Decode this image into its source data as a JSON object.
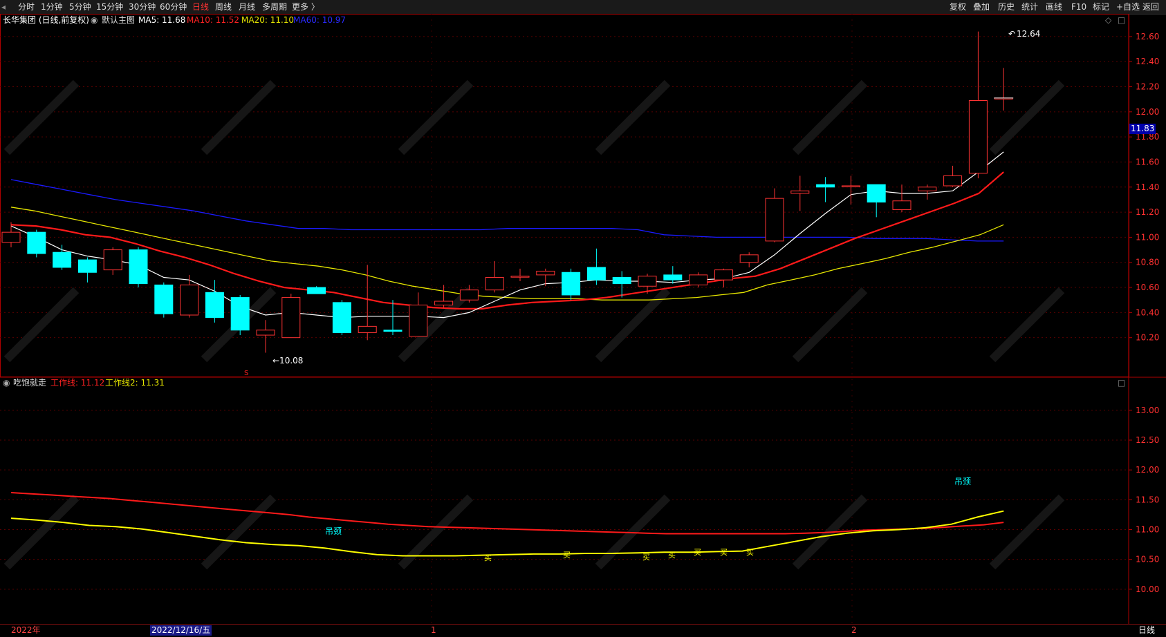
{
  "toolbar": {
    "left_tabs": [
      {
        "label": "分时"
      },
      {
        "label": "1分钟"
      },
      {
        "label": "5分钟"
      },
      {
        "label": "15分钟"
      },
      {
        "label": "30分钟"
      },
      {
        "label": "60分钟"
      },
      {
        "label": "日线"
      },
      {
        "label": "周线"
      },
      {
        "label": "月线"
      },
      {
        "label": "多周期"
      },
      {
        "label": "更多 〉"
      }
    ],
    "active_tab": "日线",
    "right_buttons": [
      {
        "label": "复权"
      },
      {
        "label": "叠加"
      },
      {
        "label": "历史"
      },
      {
        "label": "统计"
      },
      {
        "label": "画线"
      },
      {
        "label": "F10"
      },
      {
        "label": "标记"
      },
      {
        "label": "+自选"
      },
      {
        "label": "返回"
      }
    ]
  },
  "main_header": {
    "stock": "长华集团 (日线,前复权)",
    "indicator": "默认主图",
    "ma5": "MA5: 11.68",
    "ma10": "MA10: 11.52",
    "ma20": "MA20: 11.10",
    "ma60": "MA60: 10.97"
  },
  "sub_header": {
    "indicator": "吃饱就走",
    "line1": "工作线: 11.12",
    "line2": "工作线2: 11.31"
  },
  "colors": {
    "up": "#ff3333",
    "down": "#00ffff",
    "ma5": "#ffffff",
    "ma10": "#ff1a1a",
    "ma20": "#e6e600",
    "ma60": "#1a1aff",
    "grid": "#5a0000",
    "axis": "#b00000"
  },
  "annotations": {
    "high_label": "12.64",
    "low_label": "←10.08",
    "current_price": "11.83",
    "s_marker": "S",
    "diaoding": "吊颈",
    "buy": "买"
  },
  "bottom": {
    "year_label": "2022年",
    "date_label": "2022/12/16/五",
    "month1": "1",
    "month2": "2",
    "period": "日线"
  },
  "chart_data": {
    "type": "candlestick",
    "title": "长华集团 (日线,前复权)",
    "price_axis_ticks": [
      12.6,
      12.4,
      12.2,
      12.0,
      11.8,
      11.6,
      11.4,
      11.2,
      11.0,
      10.8,
      10.6,
      10.4,
      10.2
    ],
    "price_range": [
      10.0,
      12.66
    ],
    "candles": [
      {
        "o": 10.96,
        "h": 11.12,
        "l": 10.92,
        "c": 11.04
      },
      {
        "o": 11.04,
        "h": 11.06,
        "l": 10.84,
        "c": 10.87
      },
      {
        "o": 10.88,
        "h": 10.94,
        "l": 10.74,
        "c": 10.76
      },
      {
        "o": 10.82,
        "h": 10.84,
        "l": 10.64,
        "c": 10.72
      },
      {
        "o": 10.74,
        "h": 10.92,
        "l": 10.7,
        "c": 10.9
      },
      {
        "o": 10.9,
        "h": 10.92,
        "l": 10.6,
        "c": 10.63
      },
      {
        "o": 10.62,
        "h": 10.64,
        "l": 10.36,
        "c": 10.39
      },
      {
        "o": 10.38,
        "h": 10.7,
        "l": 10.36,
        "c": 10.62
      },
      {
        "o": 10.56,
        "h": 10.66,
        "l": 10.32,
        "c": 10.36
      },
      {
        "o": 10.52,
        "h": 10.54,
        "l": 10.22,
        "c": 10.26
      },
      {
        "o": 10.22,
        "h": 10.34,
        "l": 10.08,
        "c": 10.26
      },
      {
        "o": 10.2,
        "h": 10.55,
        "l": 10.2,
        "c": 10.52
      },
      {
        "o": 10.6,
        "h": 10.61,
        "l": 10.55,
        "c": 10.55
      },
      {
        "o": 10.48,
        "h": 10.5,
        "l": 10.22,
        "c": 10.24
      },
      {
        "o": 10.24,
        "h": 10.78,
        "l": 10.18,
        "c": 10.29
      },
      {
        "o": 10.26,
        "h": 10.5,
        "l": 10.22,
        "c": 10.25
      },
      {
        "o": 10.21,
        "h": 10.56,
        "l": 10.21,
        "c": 10.46
      },
      {
        "o": 10.46,
        "h": 10.62,
        "l": 10.44,
        "c": 10.49
      },
      {
        "o": 10.5,
        "h": 10.62,
        "l": 10.48,
        "c": 10.58
      },
      {
        "o": 10.58,
        "h": 10.81,
        "l": 10.56,
        "c": 10.68
      },
      {
        "o": 10.69,
        "h": 10.75,
        "l": 10.65,
        "c": 10.69
      },
      {
        "o": 10.7,
        "h": 10.75,
        "l": 10.61,
        "c": 10.73
      },
      {
        "o": 10.72,
        "h": 10.75,
        "l": 10.5,
        "c": 10.54
      },
      {
        "o": 10.76,
        "h": 10.91,
        "l": 10.62,
        "c": 10.66
      },
      {
        "o": 10.68,
        "h": 10.73,
        "l": 10.52,
        "c": 10.63
      },
      {
        "o": 10.61,
        "h": 10.71,
        "l": 10.55,
        "c": 10.69
      },
      {
        "o": 10.7,
        "h": 10.77,
        "l": 10.63,
        "c": 10.66
      },
      {
        "o": 10.62,
        "h": 10.72,
        "l": 10.6,
        "c": 10.7
      },
      {
        "o": 10.66,
        "h": 10.75,
        "l": 10.6,
        "c": 10.74
      },
      {
        "o": 10.8,
        "h": 10.88,
        "l": 10.76,
        "c": 10.86
      },
      {
        "o": 10.97,
        "h": 11.39,
        "l": 10.96,
        "c": 11.31
      },
      {
        "o": 11.35,
        "h": 11.49,
        "l": 11.21,
        "c": 11.37
      },
      {
        "o": 11.42,
        "h": 11.48,
        "l": 11.28,
        "c": 11.4
      },
      {
        "o": 11.41,
        "h": 11.49,
        "l": 11.26,
        "c": 11.41
      },
      {
        "o": 11.42,
        "h": 11.42,
        "l": 11.16,
        "c": 11.28
      },
      {
        "o": 11.22,
        "h": 11.42,
        "l": 11.2,
        "c": 11.29
      },
      {
        "o": 11.37,
        "h": 11.42,
        "l": 11.3,
        "c": 11.4
      },
      {
        "o": 11.41,
        "h": 11.57,
        "l": 11.4,
        "c": 11.49
      },
      {
        "o": 11.51,
        "h": 12.64,
        "l": 11.47,
        "c": 12.09
      },
      {
        "o": 12.11,
        "h": 12.35,
        "l": 12.01,
        "c": 12.11
      }
    ],
    "ma5": [
      11.09,
      11.0,
      10.9,
      10.85,
      10.82,
      10.78,
      10.68,
      10.66,
      10.57,
      10.45,
      10.38,
      10.4,
      10.38,
      10.36,
      10.37,
      10.37,
      10.37,
      10.36,
      10.4,
      10.49,
      10.58,
      10.63,
      10.64,
      10.66,
      10.65,
      10.65,
      10.64,
      10.66,
      10.67,
      10.72,
      10.86,
      11.03,
      11.19,
      11.34,
      11.37,
      11.35,
      11.35,
      11.37,
      11.52,
      11.68
    ],
    "ma10": [
      11.1,
      11.09,
      11.06,
      11.02,
      11.0,
      10.95,
      10.89,
      10.84,
      10.78,
      10.71,
      10.65,
      10.6,
      10.58,
      10.56,
      10.52,
      10.48,
      10.46,
      10.44,
      10.43,
      10.43,
      10.46,
      10.48,
      10.49,
      10.5,
      10.52,
      10.55,
      10.58,
      10.61,
      10.64,
      10.67,
      10.69,
      10.75,
      10.83,
      10.91,
      10.99,
      11.06,
      11.13,
      11.2,
      11.27,
      11.35,
      11.52
    ],
    "ma20": [
      11.24,
      11.21,
      11.17,
      11.13,
      11.09,
      11.05,
      11.01,
      10.97,
      10.93,
      10.89,
      10.85,
      10.81,
      10.79,
      10.77,
      10.74,
      10.7,
      10.65,
      10.61,
      10.58,
      10.55,
      10.53,
      10.52,
      10.51,
      10.51,
      10.51,
      10.5,
      10.5,
      10.5,
      10.51,
      10.52,
      10.54,
      10.56,
      10.62,
      10.66,
      10.7,
      10.75,
      10.79,
      10.83,
      10.88,
      10.92,
      10.97,
      11.02,
      11.1
    ],
    "ma60": [
      11.46,
      11.42,
      11.38,
      11.34,
      11.3,
      11.27,
      11.24,
      11.21,
      11.17,
      11.13,
      11.1,
      11.07,
      11.07,
      11.06,
      11.06,
      11.06,
      11.06,
      11.06,
      11.06,
      11.07,
      11.07,
      11.07,
      11.07,
      11.07,
      11.06,
      11.02,
      11.01,
      11.0,
      11.0,
      11.0,
      11.0,
      11.0,
      11.0,
      10.99,
      10.99,
      10.99,
      10.98,
      10.97,
      10.97
    ],
    "sub_axis_ticks": [
      13.0,
      12.5,
      12.0,
      11.5,
      11.0,
      10.5,
      10.0
    ],
    "sub_range": [
      9.5,
      13.45
    ],
    "work_line": [
      11.62,
      11.6,
      11.58,
      11.56,
      11.54,
      11.52,
      11.49,
      11.46,
      11.43,
      11.4,
      11.37,
      11.34,
      11.31,
      11.28,
      11.25,
      11.21,
      11.18,
      11.15,
      11.12,
      11.09,
      11.07,
      11.05,
      11.04,
      11.03,
      11.02,
      11.01,
      11.0,
      10.99,
      10.98,
      10.97,
      10.96,
      10.95,
      10.94,
      10.93,
      10.93,
      10.93,
      10.93,
      10.93,
      10.93,
      10.93,
      10.94,
      10.95,
      10.97,
      10.99,
      11.0,
      11.01,
      11.02,
      11.04,
      11.06,
      11.08,
      11.12
    ],
    "work_line2": [
      11.19,
      11.16,
      11.12,
      11.07,
      11.05,
      11.01,
      10.95,
      10.89,
      10.83,
      10.78,
      10.75,
      10.73,
      10.69,
      10.63,
      10.58,
      10.56,
      10.56,
      10.56,
      10.57,
      10.58,
      10.59,
      10.59,
      10.6,
      10.6,
      10.61,
      10.62,
      10.62,
      10.63,
      10.64,
      10.72,
      10.8,
      10.88,
      10.94,
      10.98,
      11.0,
      11.03,
      11.09,
      11.21,
      11.31
    ],
    "sell_markers": [
      {
        "index": 9
      }
    ],
    "buy_markers": [
      {
        "index": 18
      },
      {
        "index": 21
      },
      {
        "index": 24
      },
      {
        "index": 25
      },
      {
        "index": 26
      },
      {
        "index": 27
      },
      {
        "index": 28
      }
    ],
    "diaoding_markers": [
      {
        "index": 12
      },
      {
        "index": 36
      }
    ]
  }
}
